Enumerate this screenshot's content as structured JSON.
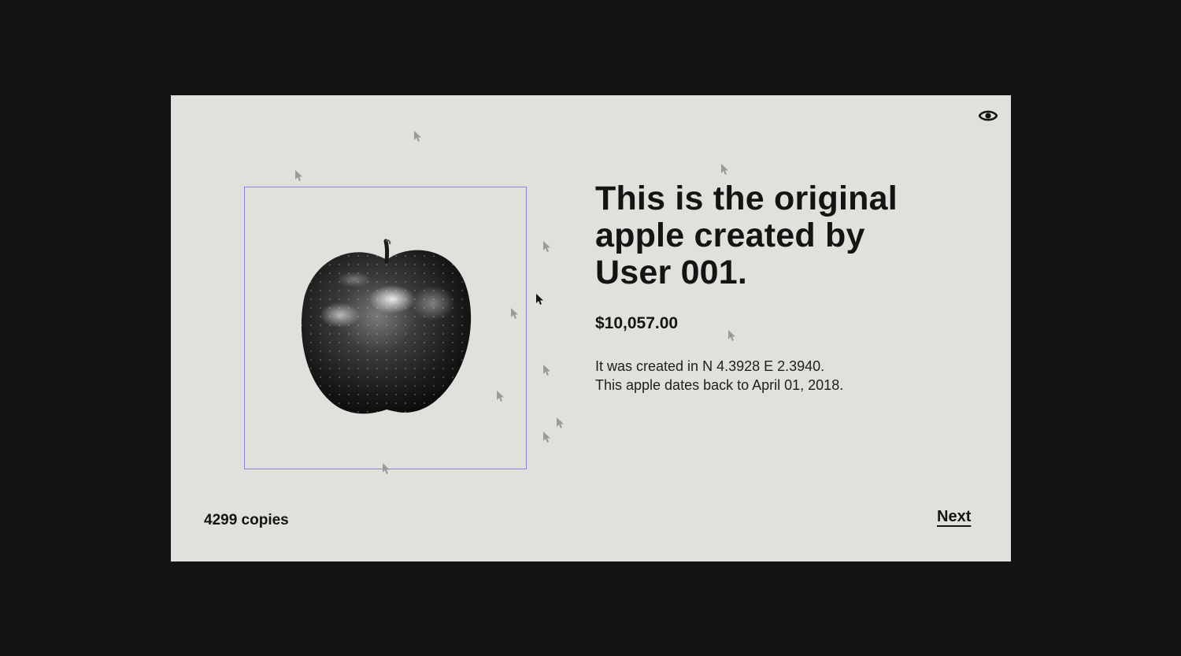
{
  "product": {
    "title": "This is the original apple created by User 001.",
    "price": "$10,057.00",
    "description_line1": "It was created in N 4.3928 E 2.3940.",
    "description_line2": "This apple dates back to April 01, 2018.",
    "copies": "4299 copies"
  },
  "nav": {
    "next_label": "Next"
  },
  "icons": {
    "view": "eye-icon",
    "pointer": "cursor-arrow-icon"
  },
  "colors": {
    "page_background": "#141414",
    "card_background": "#e2e0db",
    "frame_border": "#8a86e0",
    "text": "#141414",
    "ghost_cursor": "#9a9a98"
  }
}
